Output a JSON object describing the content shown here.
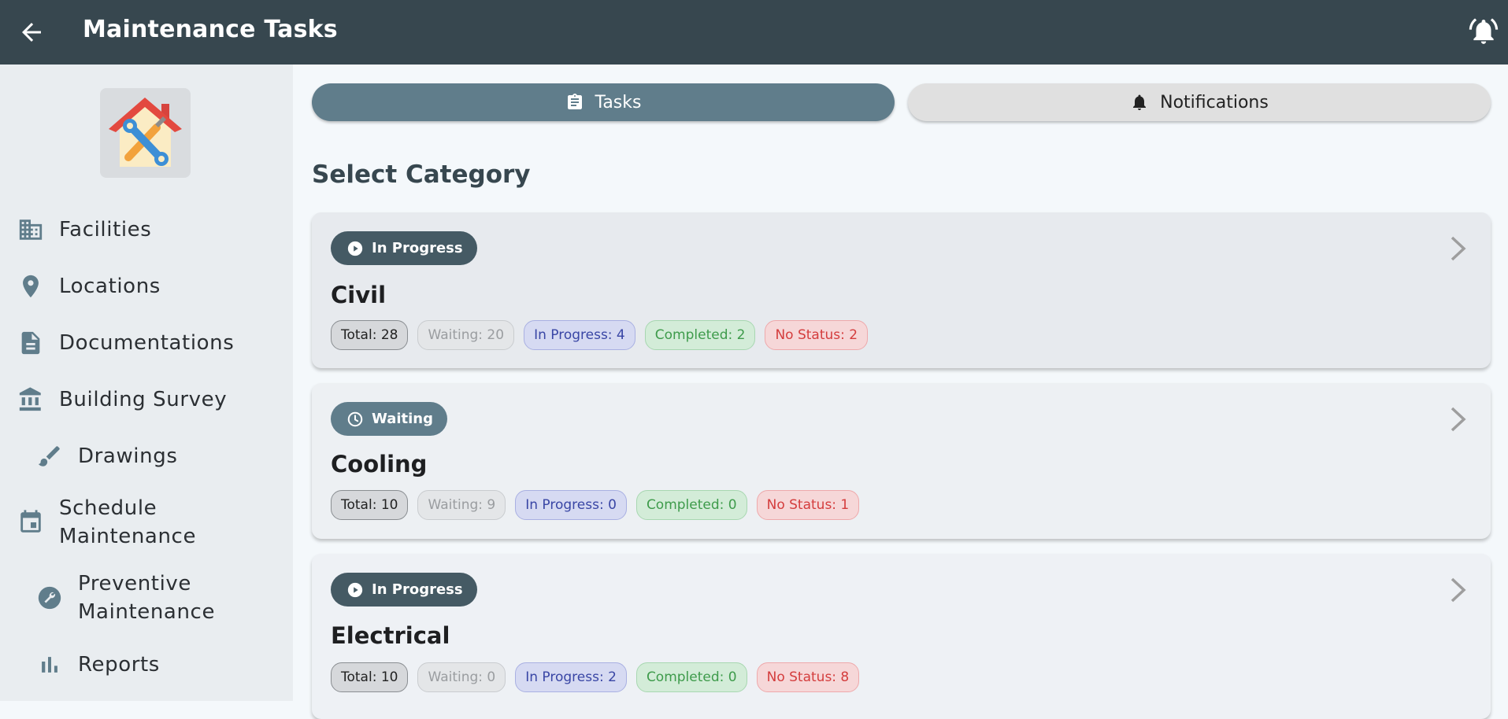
{
  "appbar": {
    "title": "Maintenance Tasks",
    "back_icon": "arrow-left-icon",
    "bell_icon": "bell-alert-icon"
  },
  "sidebar": {
    "logo_icon": "house-tools-icon",
    "items": [
      {
        "label": "Facilities",
        "icon": "building-icon"
      },
      {
        "label": "Locations",
        "icon": "location-pin-icon"
      },
      {
        "label": "Documentations",
        "icon": "document-icon"
      },
      {
        "label": "Building Survey",
        "icon": "bank-icon"
      },
      {
        "label": "Drawings",
        "icon": "brush-icon"
      },
      {
        "label": "Schedule Maintenance",
        "icon": "calendar-icon"
      },
      {
        "label": "Preventive Maintenance",
        "icon": "wrench-circle-icon"
      },
      {
        "label": "Reports",
        "icon": "bar-chart-icon"
      }
    ]
  },
  "tabs": {
    "tasks": "Tasks",
    "notifications": "Notifications"
  },
  "section_title": "Select Category",
  "categories": [
    {
      "status": "In Progress",
      "status_color": "#455a64",
      "card_bg": "#e7eaee",
      "title": "Civil",
      "chips": {
        "total": "Total: 28",
        "waiting": "Waiting: 20",
        "in_progress": "In Progress: 4",
        "completed": "Completed: 2",
        "no_status": "No Status: 2"
      }
    },
    {
      "status": "Waiting",
      "status_color": "#607d8b",
      "card_bg": "#edf0f3",
      "title": "Cooling",
      "chips": {
        "total": "Total: 10",
        "waiting": "Waiting: 9",
        "in_progress": "In Progress: 0",
        "completed": "Completed: 0",
        "no_status": "No Status: 1"
      }
    },
    {
      "status": "In Progress",
      "status_color": "#455a64",
      "card_bg": "#eef1f5",
      "title": "Electrical",
      "chips": {
        "total": "Total: 10",
        "waiting": "Waiting: 0",
        "in_progress": "In Progress: 2",
        "completed": "Completed: 0",
        "no_status": "No Status: 8"
      }
    }
  ],
  "colors": {
    "appbar": "#37474f",
    "sidebar": "#e9edf0",
    "accent": "#607d8b"
  }
}
